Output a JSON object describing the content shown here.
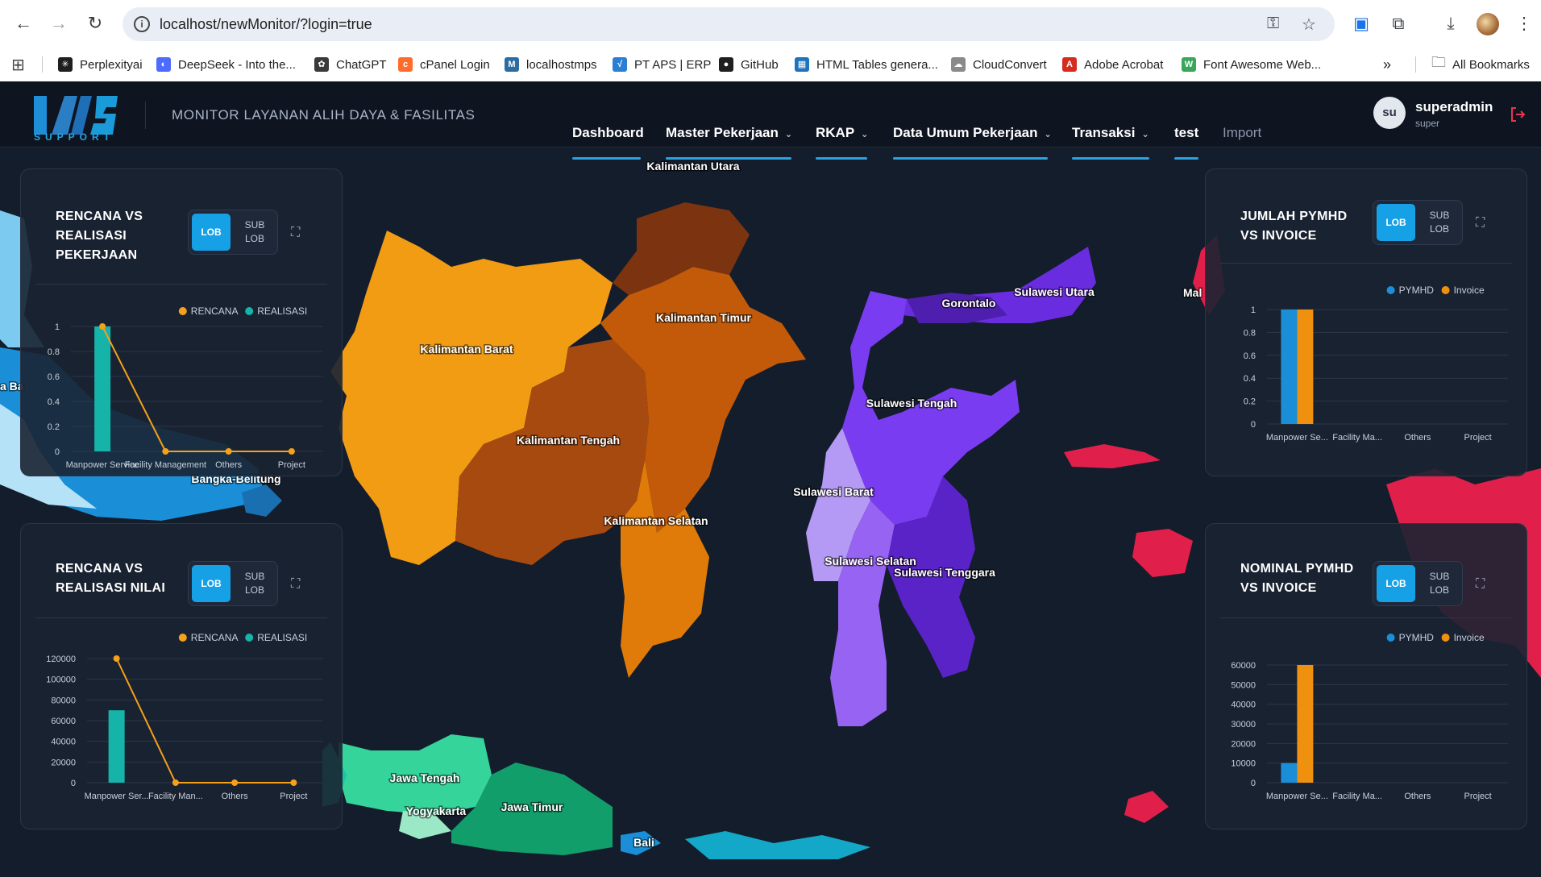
{
  "browser": {
    "url": "localhost/newMonitor/?login=true",
    "bookmarks": [
      {
        "label": "Perplexityai",
        "color": "#1f1f1f",
        "glyph": "✳"
      },
      {
        "label": "DeepSeek - Into the...",
        "color": "#4d6bfe",
        "glyph": "◐"
      },
      {
        "label": "ChatGPT",
        "color": "#3a3a3a",
        "glyph": "✿"
      },
      {
        "label": "cPanel Login",
        "color": "#ff6c2c",
        "glyph": "c"
      },
      {
        "label": "localhostmps",
        "color": "#2b6ca3",
        "glyph": "M"
      },
      {
        "label": "PT APS | ERP",
        "color": "#2a7fd4",
        "glyph": "√"
      },
      {
        "label": "GitHub",
        "color": "#1f1f1f",
        "glyph": "●"
      },
      {
        "label": "HTML Tables genera...",
        "color": "#1e73be",
        "glyph": "▦"
      },
      {
        "label": "CloudConvert",
        "color": "#8a8a8a",
        "glyph": "☁"
      },
      {
        "label": "Adobe Acrobat",
        "color": "#d62b1f",
        "glyph": "A"
      },
      {
        "label": "Font Awesome Web...",
        "color": "#3aa65a",
        "glyph": "W"
      }
    ],
    "more_label": "»",
    "all_bookmarks": "All Bookmarks"
  },
  "header": {
    "logo_sub": "SUPPORT",
    "title": "MONITOR LAYANAN ALIH DAYA & FASILITAS",
    "menu": [
      {
        "label": "Dashboard",
        "dropdown": false
      },
      {
        "label": "Master Pekerjaan",
        "dropdown": true
      },
      {
        "label": "RKAP",
        "dropdown": true
      },
      {
        "label": "Data Umum Pekerjaan",
        "dropdown": true
      },
      {
        "label": "Transaksi",
        "dropdown": true
      },
      {
        "label": "test",
        "dropdown": false
      },
      {
        "label": "Import",
        "dropdown": false
      }
    ],
    "user": {
      "initials": "su",
      "name": "superadmin",
      "role": "super"
    }
  },
  "map_labels": [
    "Kalimantan Utara",
    "Kalimantan Timur",
    "Kalimantan Barat",
    "Kalimantan Tengah",
    "Kalimantan Selatan",
    "Gorontalo",
    "Sulawesi Utara",
    "Sulawesi Tengah",
    "Sulawesi Barat",
    "Sulawesi Selatan",
    "Sulawesi Tenggara",
    "Bangka-Belitung",
    "Jawa Tengah",
    "Yogyakarta",
    "Jawa Timur",
    "Bali",
    "Mal",
    "a Ba"
  ],
  "toggle": {
    "lob": "LOB",
    "sub_line1": "SUB",
    "sub_line2": "LOB"
  },
  "panels": {
    "p1": {
      "title": [
        "RENCANA VS",
        "REALISASI",
        "PEKERJAAN"
      ]
    },
    "p2": {
      "title": [
        "RENCANA VS",
        "REALISASI NILAI"
      ]
    },
    "p3": {
      "title": [
        "JUMLAH PYMHD",
        "VS INVOICE"
      ]
    },
    "p4": {
      "title": [
        "NOMINAL PYMHD",
        "VS INVOICE"
      ]
    }
  },
  "chart_data": [
    {
      "type": "bar",
      "title": "RENCANA VS REALISASI PEKERJAAN",
      "categories": [
        "Manpower Service",
        "Facility Management",
        "Others",
        "Project"
      ],
      "series": [
        {
          "name": "REALISASI",
          "kind": "bar",
          "color": "#16b3a8",
          "values": [
            1,
            0,
            0,
            0
          ]
        },
        {
          "name": "RENCANA",
          "kind": "line",
          "color": "#f5a11a",
          "values": [
            1,
            0,
            0,
            0
          ]
        }
      ],
      "ylim": [
        0,
        1
      ],
      "yticks": [
        "0",
        "0.2",
        "0.4",
        "0.6",
        "0.8",
        "1"
      ],
      "grid": true,
      "legend": "top-right"
    },
    {
      "type": "bar",
      "title": "RENCANA VS REALISASI NILAI",
      "categories": [
        "Manpower Ser...",
        "Facility Man...",
        "Others",
        "Project"
      ],
      "series": [
        {
          "name": "REALISASI",
          "kind": "bar",
          "color": "#16b3a8",
          "values": [
            70000,
            0,
            0,
            0
          ]
        },
        {
          "name": "RENCANA",
          "kind": "line",
          "color": "#f5a11a",
          "values": [
            120000,
            0,
            0,
            0
          ]
        }
      ],
      "ylim": [
        0,
        120000
      ],
      "yticks": [
        "0",
        "20000",
        "40000",
        "60000",
        "80000",
        "100000",
        "120000"
      ],
      "grid": true,
      "legend": "top-right"
    },
    {
      "type": "bar",
      "title": "JUMLAH PYMHD VS INVOICE",
      "categories": [
        "Manpower Se...",
        "Facility Ma...",
        "Others",
        "Project"
      ],
      "series": [
        {
          "name": "PYMHD",
          "kind": "bar",
          "color": "#1a8fd8",
          "values": [
            1,
            0,
            0,
            0
          ]
        },
        {
          "name": "Invoice",
          "kind": "bar",
          "color": "#f0900f",
          "values": [
            1,
            0,
            0,
            0
          ]
        }
      ],
      "ylim": [
        0,
        1
      ],
      "yticks": [
        "0",
        "0.2",
        "0.4",
        "0.6",
        "0.8",
        "1"
      ],
      "grid": true,
      "legend": "top-right"
    },
    {
      "type": "bar",
      "title": "NOMINAL PYMHD VS INVOICE",
      "categories": [
        "Manpower Se...",
        "Facility Ma...",
        "Others",
        "Project"
      ],
      "series": [
        {
          "name": "PYMHD",
          "kind": "bar",
          "color": "#1a8fd8",
          "values": [
            10000,
            0,
            0,
            0
          ]
        },
        {
          "name": "Invoice",
          "kind": "bar",
          "color": "#f0900f",
          "values": [
            60000,
            0,
            0,
            0
          ]
        }
      ],
      "ylim": [
        0,
        60000
      ],
      "yticks": [
        "0",
        "10000",
        "20000",
        "30000",
        "40000",
        "50000",
        "60000"
      ],
      "grid": true,
      "legend": "top-right"
    }
  ]
}
